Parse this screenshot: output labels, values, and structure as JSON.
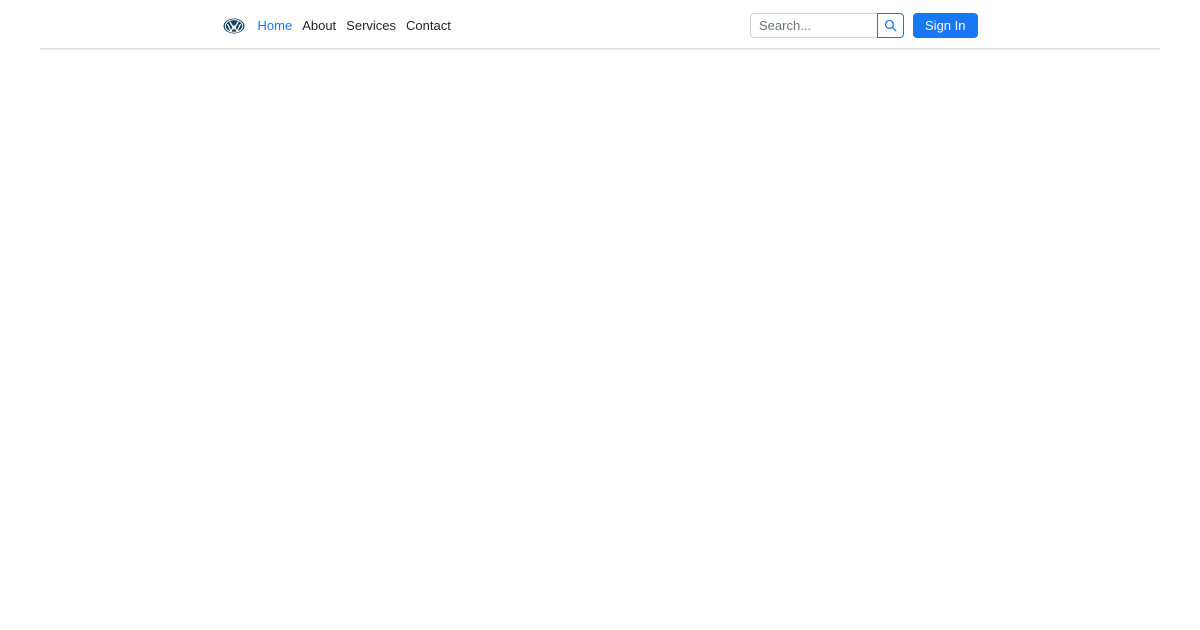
{
  "header": {
    "brand": {
      "logo_name": "vw-logo"
    },
    "nav": {
      "items": [
        {
          "label": "Home",
          "active": true
        },
        {
          "label": "About",
          "active": false
        },
        {
          "label": "Services",
          "active": false
        },
        {
          "label": "Contact",
          "active": false
        }
      ]
    },
    "search": {
      "placeholder": "Search...",
      "button_icon": "search-icon"
    },
    "sign_in_label": "Sign In"
  },
  "colors": {
    "primary_blue": "#1877f2",
    "nav_text": "#212529",
    "placeholder_text": "#6c757d",
    "input_border": "#ced4da",
    "logo_navy": "#17405f",
    "divider_gray": "#d9d9d9",
    "background": "#ffffff"
  }
}
